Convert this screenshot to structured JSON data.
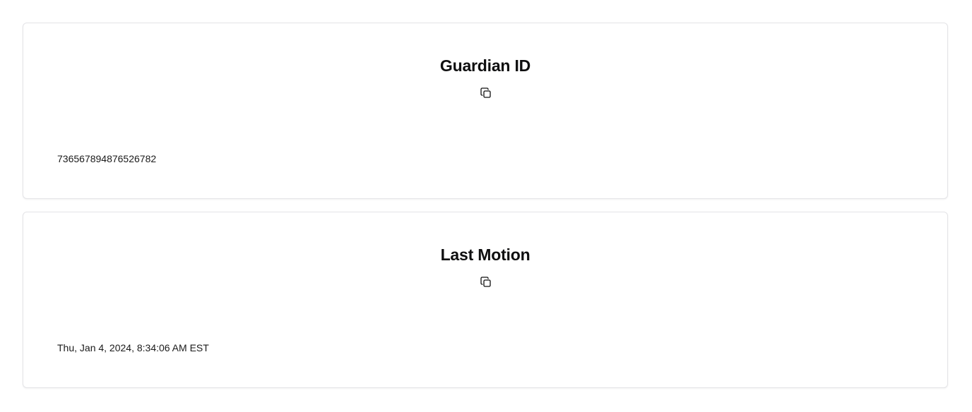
{
  "cards": [
    {
      "title": "Guardian ID",
      "value": "736567894876526782",
      "action_icon": "copy-icon"
    },
    {
      "title": "Last Motion",
      "value": "Thu, Jan 4, 2024, 8:34:06 AM EST",
      "action_icon": "copy-icon"
    }
  ],
  "colors": {
    "card_border": "#e4e4e7",
    "title_text": "#0f0f10",
    "value_text": "#1a1a1a",
    "background": "#ffffff"
  }
}
